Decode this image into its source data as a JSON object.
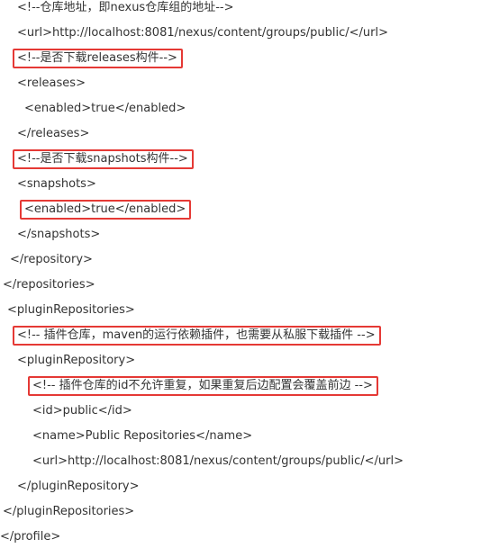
{
  "annotation_color": "#e53935",
  "lines": [
    {
      "text": "<!--仓库地址，即nexus仓库组的地址-->",
      "highlight": false
    },
    {
      "text": "<url>http://localhost:8081/nexus/content/groups/public/</url>",
      "highlight": false
    },
    {
      "text": "<!--是否下载releases构件-->",
      "highlight": true
    },
    {
      "text": "<releases>",
      "highlight": false
    },
    {
      "text": "<enabled>true</enabled>",
      "highlight": false
    },
    {
      "text": "</releases>",
      "highlight": false
    },
    {
      "text": "<!--是否下载snapshots构件-->",
      "highlight": true
    },
    {
      "text": "<snapshots>",
      "highlight": false
    },
    {
      "text": "<enabled>true</enabled>",
      "highlight": true
    },
    {
      "text": "</snapshots>",
      "highlight": false
    },
    {
      "text": "</repository>",
      "highlight": false
    },
    {
      "text": "</repositories>",
      "highlight": false
    },
    {
      "text": "<pluginRepositories>",
      "highlight": false
    },
    {
      "text": "<!-- 插件仓库，maven的运行依赖插件，也需要从私服下载插件 -->",
      "highlight": true
    },
    {
      "text": "<pluginRepository>",
      "highlight": false
    },
    {
      "text": "<!-- 插件仓库的id不允许重复，如果重复后边配置会覆盖前边 -->",
      "highlight": true
    },
    {
      "text": "<id>public</id>",
      "highlight": false
    },
    {
      "text": "<name>Public Repositories</name>",
      "highlight": false
    },
    {
      "text": "<url>http://localhost:8081/nexus/content/groups/public/</url>",
      "highlight": false
    },
    {
      "text": "</pluginRepository>",
      "highlight": false
    },
    {
      "text": "</pluginRepositories>",
      "highlight": false
    },
    {
      "text": "</profile>",
      "highlight": false
    }
  ]
}
